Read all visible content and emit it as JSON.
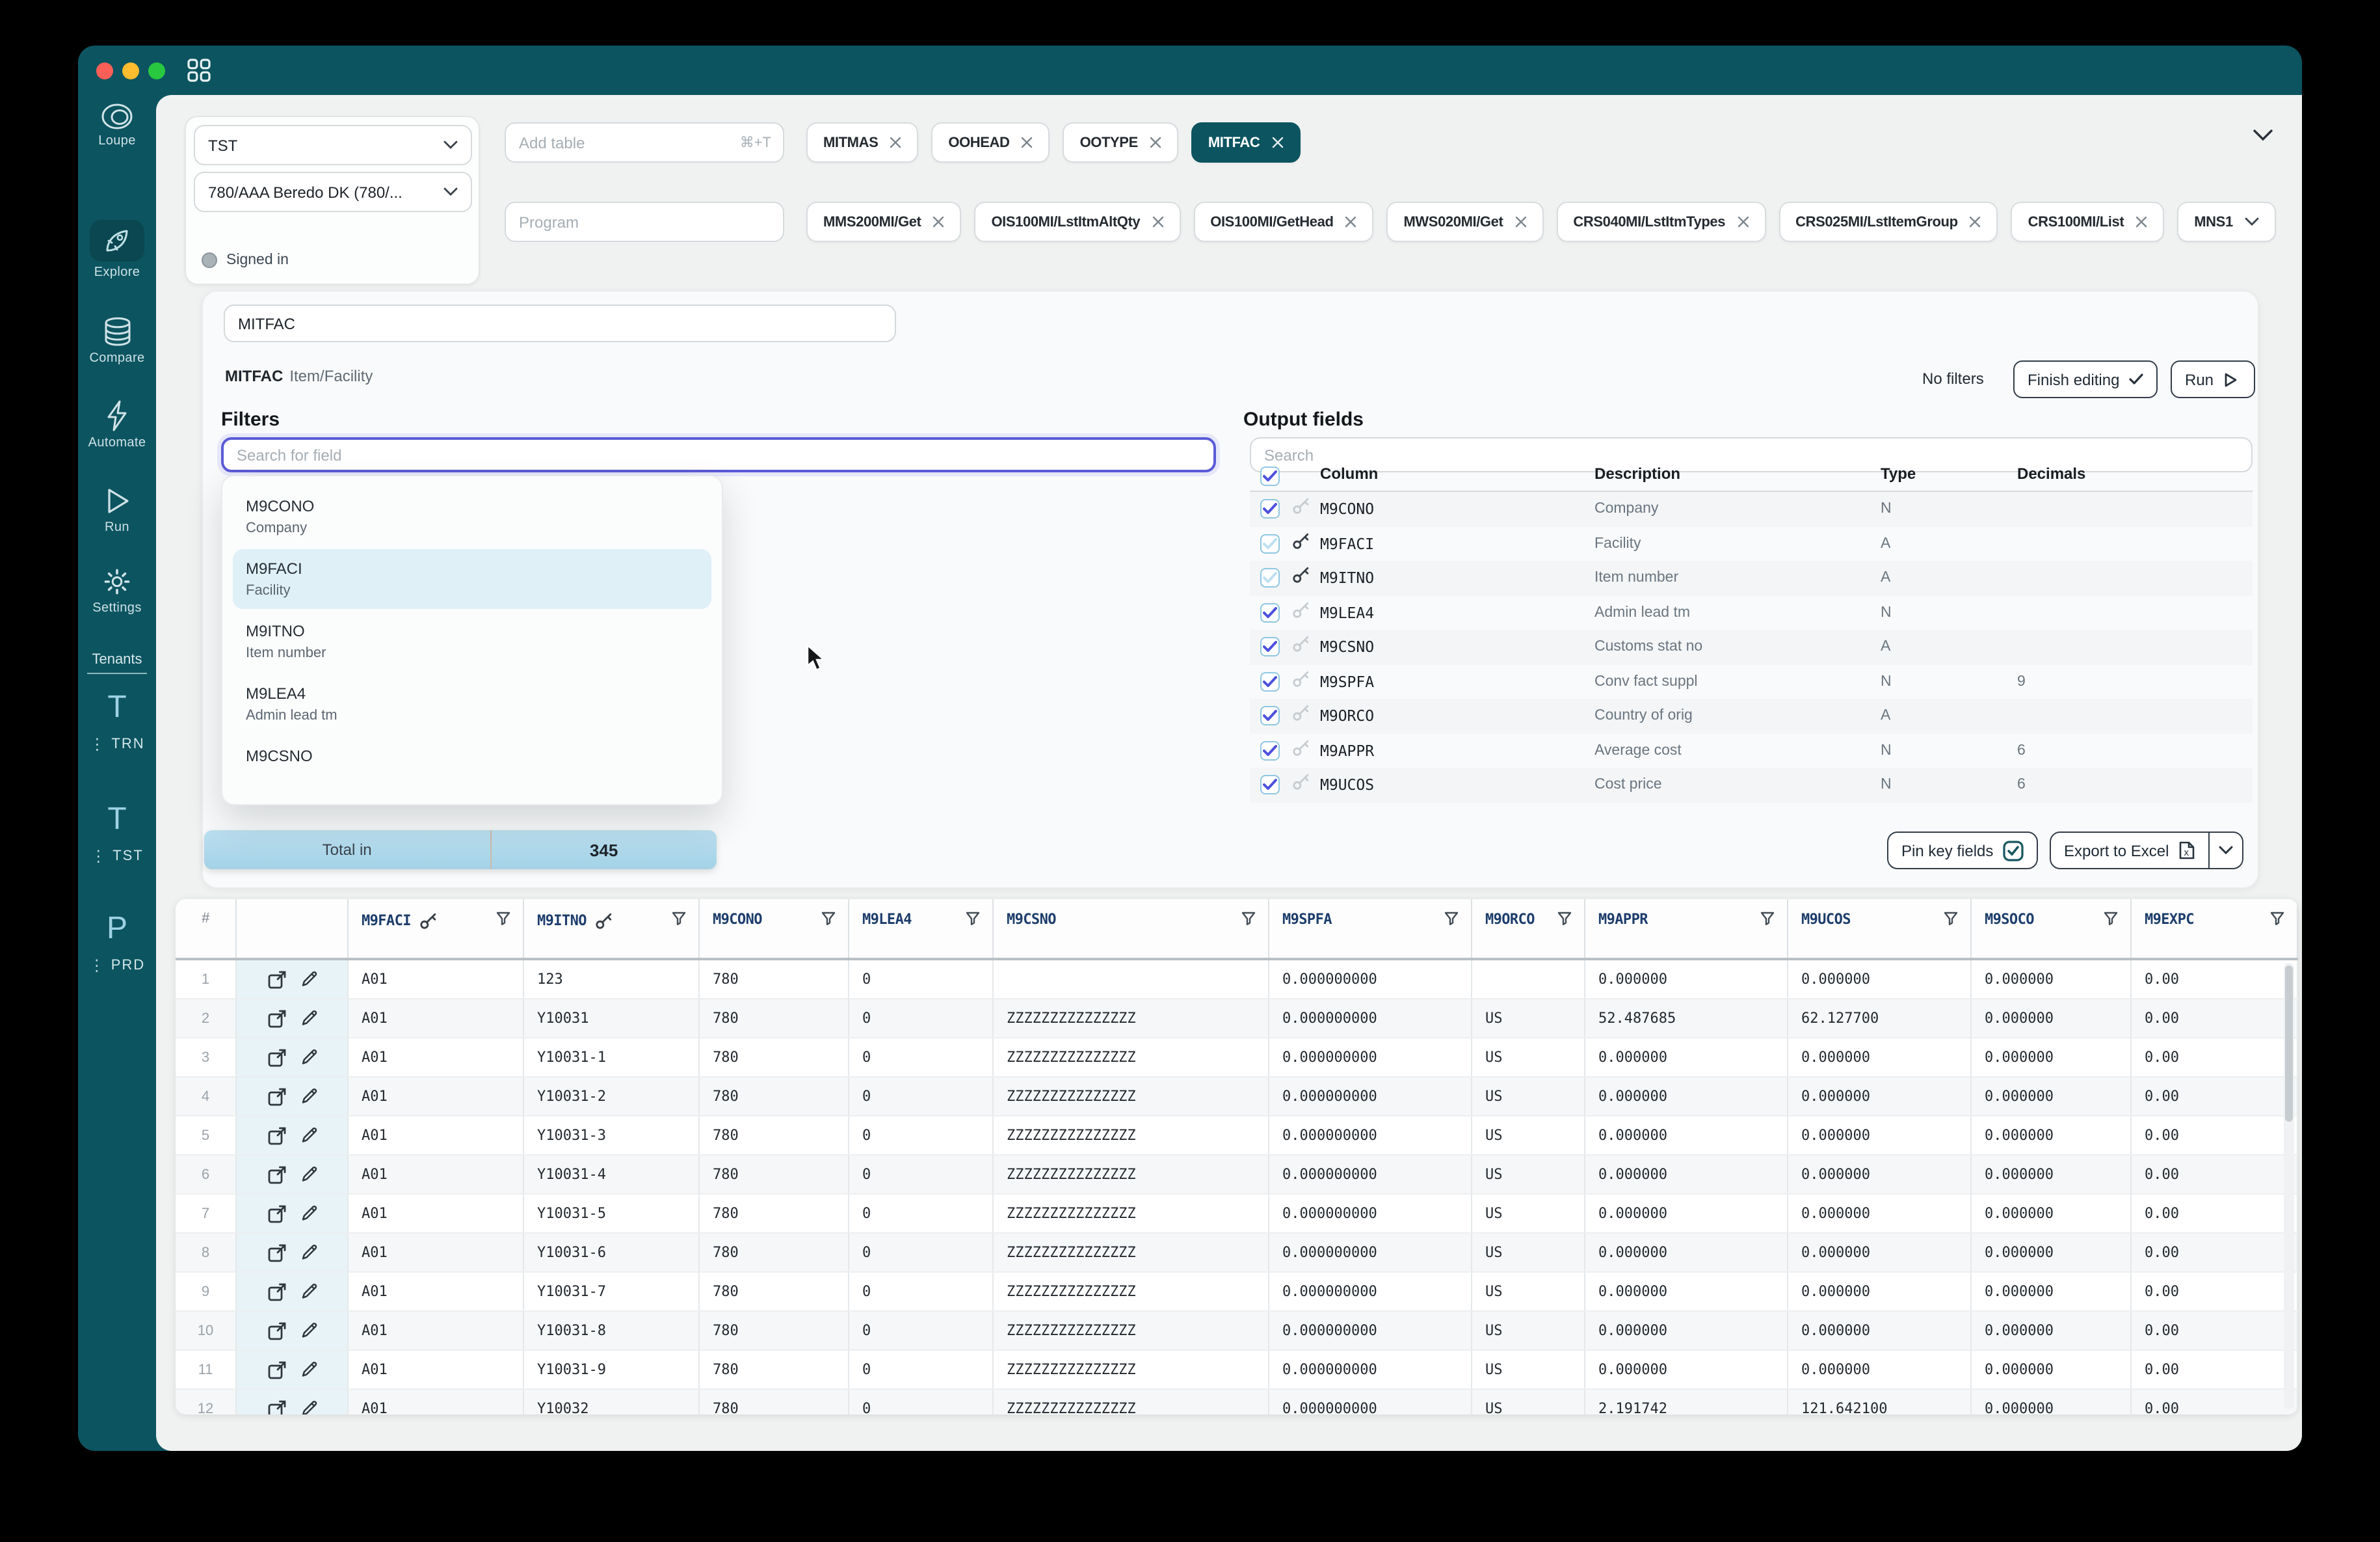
{
  "colors": {
    "sidebar_teal": "#0c5460",
    "active_item": "#0a4750",
    "chip_active": "#0c5460",
    "focus_border": "#5b5bd6",
    "accent_indigo": "#4d51dc",
    "selection_highlight": "#dff0f7",
    "grid_header_text": "#1d3d6b",
    "total_bar": "#aed9ea"
  },
  "sidebar": {
    "items": [
      {
        "id": "loupe",
        "label": "Loupe",
        "active": false
      },
      {
        "id": "explore",
        "label": "Explore",
        "active": true
      },
      {
        "id": "compare",
        "label": "Compare",
        "active": false
      },
      {
        "id": "automate",
        "label": "Automate",
        "active": false
      },
      {
        "id": "run",
        "label": "Run",
        "active": false
      },
      {
        "id": "settings",
        "label": "Settings",
        "active": false
      }
    ],
    "tenants_label": "Tenants",
    "tenants": [
      {
        "initial": "T",
        "code": "TRN"
      },
      {
        "initial": "T",
        "code": "TST"
      },
      {
        "initial": "P",
        "code": "PRD"
      }
    ]
  },
  "connection": {
    "environment": "TST",
    "company": "780/AAA Beredo DK (780/...",
    "status": "Signed in"
  },
  "tables": {
    "placeholder": "Add table",
    "shortcut": "⌘+T",
    "chips": [
      {
        "label": "MITMAS",
        "active": false
      },
      {
        "label": "OOHEAD",
        "active": false
      },
      {
        "label": "OOTYPE",
        "active": false
      },
      {
        "label": "MITFAC",
        "active": true
      }
    ]
  },
  "programs": {
    "placeholder": "Program",
    "chips": [
      {
        "label": "MMS200MI/Get"
      },
      {
        "label": "OIS100MI/LstItmAltQty"
      },
      {
        "label": "OIS100MI/GetHead"
      },
      {
        "label": "MWS020MI/Get"
      },
      {
        "label": "CRS040MI/LstItmTypes"
      },
      {
        "label": "CRS025MI/LstItemGroup"
      },
      {
        "label": "CRS100MI/List"
      },
      {
        "label": "MNS1",
        "more": true
      }
    ]
  },
  "query": {
    "value": "MITFAC",
    "code": "MITFAC",
    "desc": "Item/Facility"
  },
  "toolbar": {
    "no_filters": "No filters",
    "finish_editing": "Finish editing",
    "run": "Run"
  },
  "filters": {
    "heading": "Filters",
    "search_placeholder": "Search for field",
    "highlighted_index": 1,
    "options": [
      {
        "code": "M9CONO",
        "desc": "Company"
      },
      {
        "code": "M9FACI",
        "desc": "Facility"
      },
      {
        "code": "M9ITNO",
        "desc": "Item number"
      },
      {
        "code": "M9LEA4",
        "desc": "Admin lead tm"
      },
      {
        "code": "M9CSNO",
        "desc": ""
      }
    ]
  },
  "output": {
    "heading": "Output fields",
    "search_placeholder": "Search",
    "columns": [
      "Column",
      "Description",
      "Type",
      "Decimals"
    ],
    "rows": [
      {
        "code": "M9CONO",
        "desc": "Company",
        "type": "N",
        "decimals": "",
        "key": "light",
        "checkbox": "strong"
      },
      {
        "code": "M9FACI",
        "desc": "Facility",
        "type": "A",
        "decimals": "",
        "key": "dark",
        "checkbox": "muted"
      },
      {
        "code": "M9ITNO",
        "desc": "Item number",
        "type": "A",
        "decimals": "",
        "key": "dark",
        "checkbox": "muted"
      },
      {
        "code": "M9LEA4",
        "desc": "Admin lead tm",
        "type": "N",
        "decimals": "",
        "key": "light",
        "checkbox": "strong"
      },
      {
        "code": "M9CSNO",
        "desc": "Customs stat no",
        "type": "A",
        "decimals": "",
        "key": "light",
        "checkbox": "strong"
      },
      {
        "code": "M9SPFA",
        "desc": "Conv fact suppl",
        "type": "N",
        "decimals": "9",
        "key": "light",
        "checkbox": "strong"
      },
      {
        "code": "M9ORCO",
        "desc": "Country of orig",
        "type": "A",
        "decimals": "",
        "key": "light",
        "checkbox": "strong"
      },
      {
        "code": "M9APPR",
        "desc": "Average cost",
        "type": "N",
        "decimals": "6",
        "key": "light",
        "checkbox": "strong"
      },
      {
        "code": "M9UCOS",
        "desc": "Cost price",
        "type": "N",
        "decimals": "6",
        "key": "light",
        "checkbox": "strong"
      }
    ]
  },
  "total": {
    "label": "Total in",
    "value": "345"
  },
  "footer_actions": {
    "pin": "Pin key fields",
    "export": "Export to Excel"
  },
  "grid": {
    "columns": [
      {
        "label": "#"
      },
      {
        "label": ""
      },
      {
        "label": "M9FACI",
        "keyed": true,
        "filter": true
      },
      {
        "label": "M9ITNO",
        "keyed": true,
        "filter": true
      },
      {
        "label": "M9CONO",
        "filter": true
      },
      {
        "label": "M9LEA4",
        "filter": true
      },
      {
        "label": "M9CSNO",
        "filter": true
      },
      {
        "label": "M9SPFA",
        "filter": true
      },
      {
        "label": "M9ORCO",
        "filter": true
      },
      {
        "label": "M9APPR",
        "filter": true
      },
      {
        "label": "M9UCOS",
        "filter": true
      },
      {
        "label": "M9SOCO",
        "filter": true
      },
      {
        "label": "M9EXPC",
        "filter": true
      }
    ],
    "rows": [
      [
        "1",
        "A01",
        "123",
        "780",
        "0",
        "",
        "0.000000000",
        "",
        "0.000000",
        "0.000000",
        "0.000000",
        "0.00"
      ],
      [
        "2",
        "A01",
        "Y10031",
        "780",
        "0",
        "ZZZZZZZZZZZZZZZ",
        "0.000000000",
        "US",
        "52.487685",
        "62.127700",
        "0.000000",
        "0.00"
      ],
      [
        "3",
        "A01",
        "Y10031-1",
        "780",
        "0",
        "ZZZZZZZZZZZZZZZ",
        "0.000000000",
        "US",
        "0.000000",
        "0.000000",
        "0.000000",
        "0.00"
      ],
      [
        "4",
        "A01",
        "Y10031-2",
        "780",
        "0",
        "ZZZZZZZZZZZZZZZ",
        "0.000000000",
        "US",
        "0.000000",
        "0.000000",
        "0.000000",
        "0.00"
      ],
      [
        "5",
        "A01",
        "Y10031-3",
        "780",
        "0",
        "ZZZZZZZZZZZZZZZ",
        "0.000000000",
        "US",
        "0.000000",
        "0.000000",
        "0.000000",
        "0.00"
      ],
      [
        "6",
        "A01",
        "Y10031-4",
        "780",
        "0",
        "ZZZZZZZZZZZZZZZ",
        "0.000000000",
        "US",
        "0.000000",
        "0.000000",
        "0.000000",
        "0.00"
      ],
      [
        "7",
        "A01",
        "Y10031-5",
        "780",
        "0",
        "ZZZZZZZZZZZZZZZ",
        "0.000000000",
        "US",
        "0.000000",
        "0.000000",
        "0.000000",
        "0.00"
      ],
      [
        "8",
        "A01",
        "Y10031-6",
        "780",
        "0",
        "ZZZZZZZZZZZZZZZ",
        "0.000000000",
        "US",
        "0.000000",
        "0.000000",
        "0.000000",
        "0.00"
      ],
      [
        "9",
        "A01",
        "Y10031-7",
        "780",
        "0",
        "ZZZZZZZZZZZZZZZ",
        "0.000000000",
        "US",
        "0.000000",
        "0.000000",
        "0.000000",
        "0.00"
      ],
      [
        "10",
        "A01",
        "Y10031-8",
        "780",
        "0",
        "ZZZZZZZZZZZZZZZ",
        "0.000000000",
        "US",
        "0.000000",
        "0.000000",
        "0.000000",
        "0.00"
      ],
      [
        "11",
        "A01",
        "Y10031-9",
        "780",
        "0",
        "ZZZZZZZZZZZZZZZ",
        "0.000000000",
        "US",
        "0.000000",
        "0.000000",
        "0.000000",
        "0.00"
      ],
      [
        "12",
        "A01",
        "Y10032",
        "780",
        "0",
        "ZZZZZZZZZZZZZZZ",
        "0.000000000",
        "US",
        "2.191742",
        "121.642100",
        "0.000000",
        "0.00"
      ]
    ]
  }
}
